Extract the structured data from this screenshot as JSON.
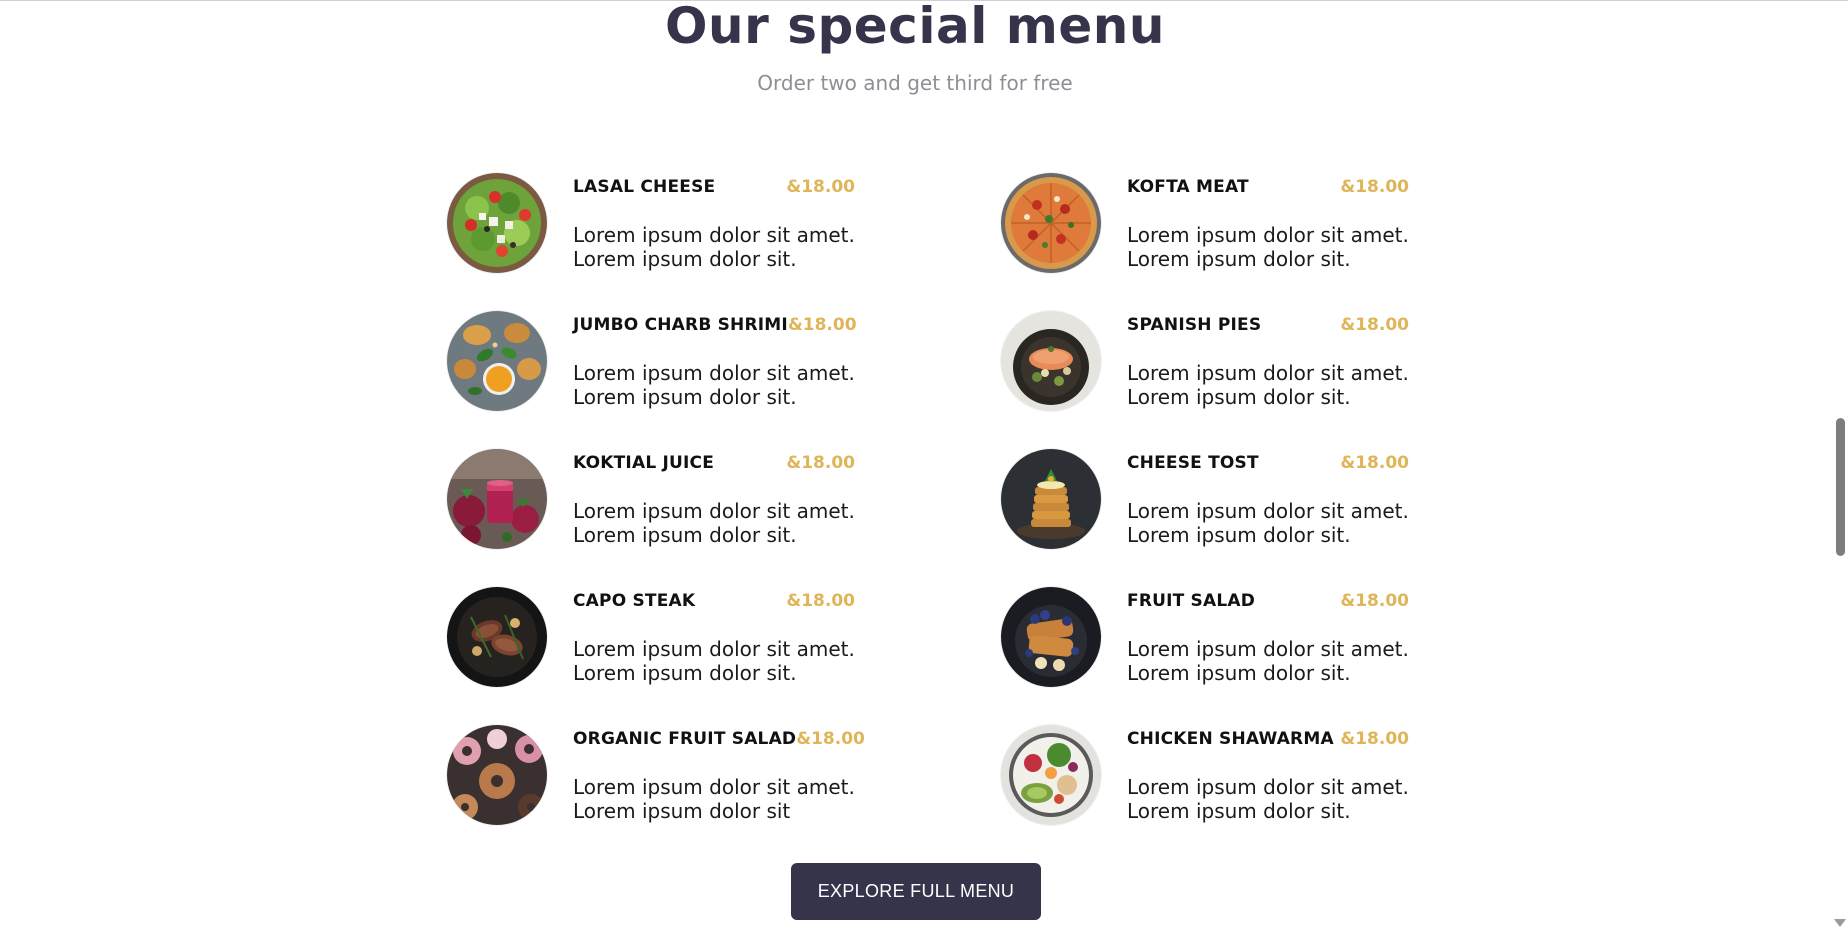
{
  "header": {
    "title": "Our special menu",
    "subtitle": "Order two and get third for free"
  },
  "menu": {
    "items": [
      {
        "name": "LASAL CHEESE",
        "price": "&18.00",
        "desc_line1": "Lorem ipsum dolor sit amet.",
        "desc_line2": "Lorem ipsum dolor sit.",
        "image": "salad-photo"
      },
      {
        "name": "KOFTA MEAT",
        "price": "&18.00",
        "desc_line1": "Lorem ipsum dolor sit amet.",
        "desc_line2": "Lorem ipsum dolor sit.",
        "image": "pizza-photo"
      },
      {
        "name": "JUMBO CHARB SHRIMI",
        "price": "&18.00",
        "desc_line1": "Lorem ipsum dolor sit amet.",
        "desc_line2": "Lorem ipsum dolor sit.",
        "image": "pasta-sauce-photo"
      },
      {
        "name": "SPANISH PIES",
        "price": "&18.00",
        "desc_line1": "Lorem ipsum dolor sit amet.",
        "desc_line2": "Lorem ipsum dolor sit.",
        "image": "fish-plate-photo"
      },
      {
        "name": "KOKTIAL JUICE",
        "price": "&18.00",
        "desc_line1": "Lorem ipsum dolor sit amet.",
        "desc_line2": "Lorem ipsum dolor sit.",
        "image": "beet-juice-photo"
      },
      {
        "name": "CHEESE TOST",
        "price": "&18.00",
        "desc_line1": "Lorem ipsum dolor sit amet.",
        "desc_line2": "Lorem ipsum dolor sit.",
        "image": "pancake-stack-photo"
      },
      {
        "name": "CAPO STEAK",
        "price": "&18.00",
        "desc_line1": "Lorem ipsum dolor sit amet.",
        "desc_line2": "Lorem ipsum dolor sit.",
        "image": "steak-pan-photo"
      },
      {
        "name": "FRUIT SALAD",
        "price": "&18.00",
        "desc_line1": "Lorem ipsum dolor sit amet.",
        "desc_line2": "Lorem ipsum dolor sit.",
        "image": "french-toast-photo"
      },
      {
        "name": "ORGANIC FRUIT SALAD",
        "price": "&18.00",
        "desc_line1": "Lorem ipsum dolor sit amet.",
        "desc_line2": "Lorem ipsum dolor sit",
        "image": "donuts-photo"
      },
      {
        "name": "CHICKEN SHAWARMA",
        "price": "&18.00",
        "desc_line1": "Lorem ipsum dolor sit amet.",
        "desc_line2": "Lorem ipsum dolor sit.",
        "image": "veggie-bowl-photo"
      }
    ]
  },
  "cta": {
    "label": "EXPLORE FULL MENU"
  },
  "colors": {
    "title": "#35344a",
    "subtitle": "#8e8e95",
    "price": "#e0b559",
    "button_bg": "#35344a",
    "button_text": "#ffffff"
  }
}
